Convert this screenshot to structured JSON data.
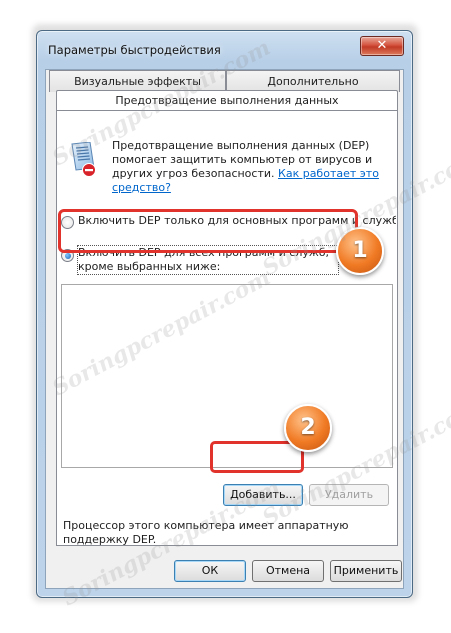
{
  "window": {
    "title": "Параметры быстродействия",
    "close_glyph": "✕"
  },
  "tabs": [
    {
      "label": "Визуальные эффекты"
    },
    {
      "label": "Дополнительно"
    }
  ],
  "subtab": {
    "label": "Предотвращение выполнения данных"
  },
  "description": {
    "text": "Предотвращение выполнения данных (DEP) помогает защитить компьютер от вирусов и других угроз безопасности. ",
    "link": "Как работает это средство?"
  },
  "options": {
    "essential_only": {
      "label": "Включить DEP только для основных программ и служб Windows",
      "checked": false
    },
    "all_except": {
      "label": "Включить DEP для всех программ и служб, кроме выбранных ниже:",
      "checked": true
    }
  },
  "buttons": {
    "add": "Добавить...",
    "remove": "Удалить",
    "ok": "ОК",
    "cancel": "Отмена",
    "apply": "Применить"
  },
  "footer_text": "Процессор этого компьютера имеет аппаратную поддержку DEP.",
  "badges": {
    "first": "1",
    "second": "2"
  },
  "watermark": "Soringpcrepair.com",
  "colors": {
    "highlight": "#e1322b",
    "badge": "#f07a24",
    "link": "#0066cc"
  },
  "icons": {
    "dep": "dep-shield-icon",
    "close": "close-icon"
  }
}
